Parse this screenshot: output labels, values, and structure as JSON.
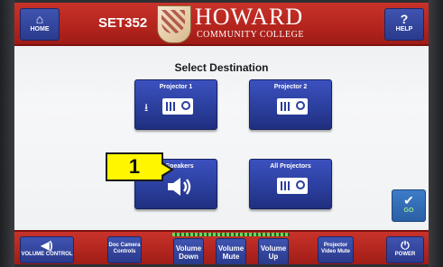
{
  "header": {
    "home_label": "HOME",
    "room_code": "SET352",
    "logo_name": "HOWARD",
    "logo_sub": "COMMUNITY COLLEGE",
    "help_label": "HELP",
    "help_glyph": "?"
  },
  "main": {
    "title": "Select Destination",
    "destinations": [
      {
        "label": "Projector 1",
        "icon": "projector-icon"
      },
      {
        "label": "Projector 2",
        "icon": "projector-icon"
      },
      {
        "label": "m Speakers",
        "icon": "speaker-icon"
      },
      {
        "label": "All Projectors",
        "icon": "projector-icon"
      }
    ],
    "go_label": "GO"
  },
  "callout": {
    "number": "1"
  },
  "footer": {
    "volume_control": "VOLUME CONTROL",
    "doc_camera": "Doc Camera Controls",
    "volume_down": "Volume Down",
    "volume_mute": "Volume Mute",
    "volume_up": "Volume Up",
    "projector_video_mute": "Projector Video Mute",
    "power": "POWER"
  },
  "colors": {
    "header_red": "#b3241d",
    "button_blue": "#2b3f9e",
    "callout_yellow": "#fff600",
    "go_green": "#9be28f"
  }
}
